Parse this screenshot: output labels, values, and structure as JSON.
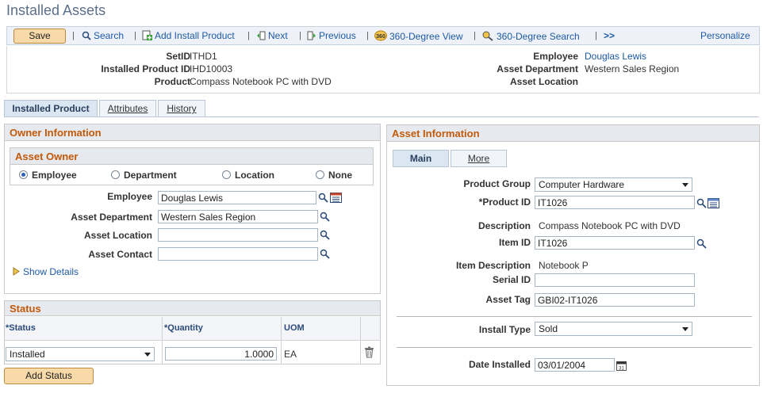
{
  "page": {
    "title": "Installed Assets"
  },
  "toolbar": {
    "save_label": "Save",
    "search_label": "Search",
    "add_label": "Add Install Product",
    "next_label": "Next",
    "previous_label": "Previous",
    "view360_label": "360-Degree View",
    "search360_label": "360-Degree Search",
    "more_label": ">>",
    "personalize_label": "Personalize"
  },
  "header": {
    "setid_label": "SetID",
    "setid": "ITHD1",
    "ipid_label": "Installed Product ID",
    "ipid": "IHD10003",
    "product_label": "Product",
    "product": "Compass Notebook PC with DVD",
    "employee_label": "Employee",
    "employee": "Douglas Lewis",
    "dept_label": "Asset Department",
    "dept": "Western Sales Region",
    "location_label": "Asset Location"
  },
  "tabs": {
    "installed_product": "Installed Product",
    "attributes": "Attributes",
    "history": "History"
  },
  "owner": {
    "title": "Owner Information",
    "asset_owner_title": "Asset Owner",
    "radio_employee": "Employee",
    "radio_department": "Department",
    "radio_location": "Location",
    "radio_none": "None",
    "employee_label": "Employee",
    "employee_value": "Douglas Lewis",
    "dept_label": "Asset Department",
    "dept_value": "Western Sales Region",
    "location_label": "Asset Location",
    "location_value": "",
    "contact_label": "Asset Contact",
    "contact_value": "",
    "show_details": "Show Details"
  },
  "status": {
    "title": "Status",
    "col_status": "*Status",
    "col_quantity": "*Quantity",
    "col_uom": "UOM",
    "row_status": "Installed",
    "row_quantity": "1.0000",
    "row_uom": "EA",
    "add_button": "Add Status"
  },
  "asset_info": {
    "title": "Asset Information",
    "tab_main": "Main",
    "tab_more": "More",
    "product_group_label": "Product Group",
    "product_group": "Computer Hardware",
    "product_id_label": "*Product ID",
    "product_id": "IT1026",
    "description_label": "Description",
    "description": "Compass Notebook PC with DVD",
    "item_id_label": "Item ID",
    "item_id": "IT1026",
    "item_desc_label": "Item Description",
    "item_desc": "Notebook P",
    "serial_label": "Serial ID",
    "serial": "",
    "asset_tag_label": "Asset Tag",
    "asset_tag": "GBI02-IT1026",
    "install_type_label": "Install Type",
    "install_type": "Sold",
    "date_label": "Date Installed",
    "date": "03/01/2004"
  },
  "colors": {
    "accent": "#c25a0a",
    "link": "#1d5aa6",
    "button": "#f8d9a8"
  }
}
